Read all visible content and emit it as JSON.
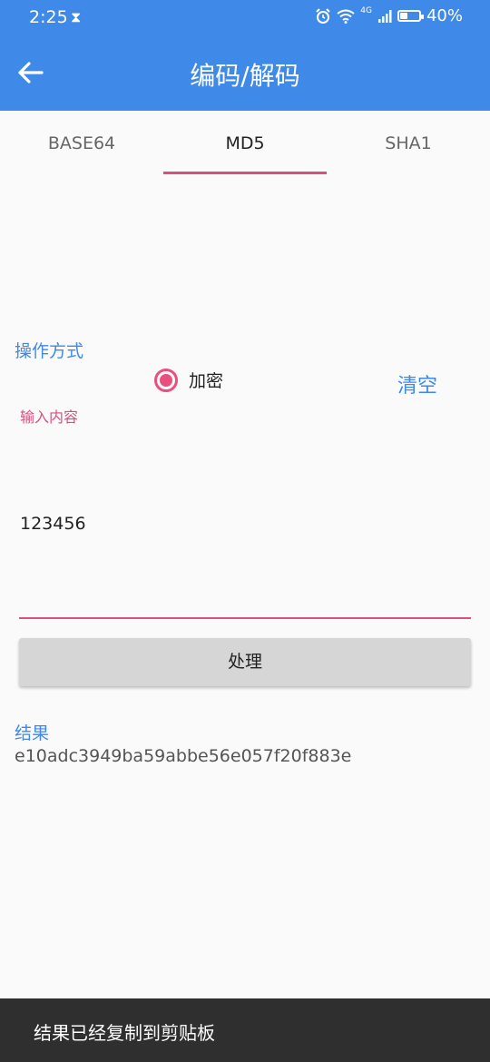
{
  "status_bar": {
    "time": "2:25",
    "icons": [
      "hourglass-icon",
      "alarm-icon",
      "wifi-icon",
      "signal-icon",
      "battery-icon"
    ],
    "network": "4G",
    "battery_percent": "40%",
    "battery_level": 0.4
  },
  "app_bar": {
    "title": "编码/解码",
    "back_icon": "arrow-left-icon"
  },
  "tabs": [
    {
      "label": "BASE64",
      "active": false
    },
    {
      "label": "MD5",
      "active": true
    },
    {
      "label": "SHA1",
      "active": false
    }
  ],
  "form": {
    "operation_label": "操作方式",
    "radio_option": "加密",
    "radio_selected": true,
    "clear_label": "清空",
    "input_hint": "输入内容",
    "input_value": "123456",
    "process_label": "处理"
  },
  "result": {
    "label": "结果",
    "value": "e10adc3949ba59abbe56e057f20f883e"
  },
  "toast": {
    "text": "结果已经复制到剪贴板"
  },
  "colors": {
    "primary": "#3f8ae8",
    "accent": "#e8517e",
    "background": "#fafafa",
    "toast_bg": "#2f2f2f"
  }
}
